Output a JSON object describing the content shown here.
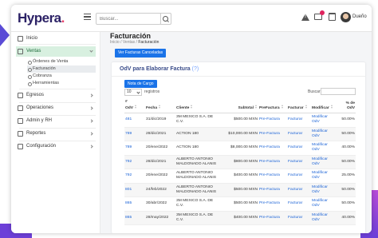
{
  "app": {
    "logo_text": "Hypera",
    "logo_dot": ".",
    "search_placeholder": "Buscar...",
    "user_name": "Dueño",
    "brand_color": "#2c2266",
    "accent_color": "#1a73e8"
  },
  "sidebar": {
    "inicio": "Inicio",
    "ventas": "Ventas",
    "ventas_sub": [
      "Órdenes de Venta",
      "Facturación",
      "Cobranza",
      "Herramientas"
    ],
    "egresos": "Egresos",
    "operaciones": "Operaciones",
    "admin": "Admin y RH",
    "reportes": "Reportes",
    "configuracion": "Configuración"
  },
  "page": {
    "title": "Facturación",
    "crumb_home": "Inicio",
    "crumb_sep": "/",
    "crumb_section": "Ventas",
    "crumb_current": "Facturación",
    "cancel_button": "Ver Facturas Canceladas"
  },
  "card": {
    "title": "OdV para Elaborar Factura",
    "title_count": "(?)",
    "new_charge_button": "Nota de Cargo",
    "page_length": "10",
    "page_length_label": "registros",
    "search_label": "Buscar:"
  },
  "table": {
    "headers": [
      "#\nOdV",
      "Fecha",
      "Cliente",
      "Subtotal",
      "PreFactura",
      "Facturar",
      "Modificar",
      "% de\nOdV"
    ],
    "rows": [
      {
        "odv": "481",
        "fecha": "31/dic/2019",
        "cliente": "3M MEXICO S.A. DE C.V.",
        "subtotal": "$500.00 MXN",
        "pre": "Pre-Factura",
        "fact": "Facturar",
        "mod": "Modificar OdV",
        "pct": "50.00%"
      },
      {
        "odv": "789",
        "fecha": "28/dic/2021",
        "cliente": "ACTION 180",
        "subtotal": "$10,000.00 MXN",
        "pre": "Pre-Factura",
        "fact": "Facturar",
        "mod": "Modificar OdV",
        "pct": "50.00%"
      },
      {
        "odv": "789",
        "fecha": "20/ene/2022",
        "cliente": "ACTION 180",
        "subtotal": "$8,000.00 MXN",
        "pre": "Pre-Factura",
        "fact": "Facturar",
        "mod": "Modificar OdV",
        "pct": "40.00%"
      },
      {
        "odv": "792",
        "fecha": "28/dic/2021",
        "cliente": "ALBERTO ANTONIO MALDONADO ALANIS",
        "subtotal": "$800.00 MXN",
        "pre": "Pre-Factura",
        "fact": "Facturar",
        "mod": "Modificar OdV",
        "pct": "50.00%"
      },
      {
        "odv": "792",
        "fecha": "20/ene/2022",
        "cliente": "ALBERTO ANTONIO MALDONADO ALANIS",
        "subtotal": "$400.00 MXN",
        "pre": "Pre-Factura",
        "fact": "Facturar",
        "mod": "Modificar OdV",
        "pct": "25.00%"
      },
      {
        "odv": "801",
        "fecha": "24/feb/2022",
        "cliente": "ALBERTO ANTONIO MALDONADO ALANIS",
        "subtotal": "$500.00 MXN",
        "pre": "Pre-Factura",
        "fact": "Facturar",
        "mod": "Modificar OdV",
        "pct": "50.00%"
      },
      {
        "odv": "865",
        "fecha": "30/abr/2022",
        "cliente": "3M MEXICO S.A. DE C.V.",
        "subtotal": "$500.00 MXN",
        "pre": "Pre-Factura",
        "fact": "Facturar",
        "mod": "Modificar OdV",
        "pct": "50.00%"
      },
      {
        "odv": "865",
        "fecha": "28/may/2022",
        "cliente": "3M MEXICO S.A. DE C.V.",
        "subtotal": "$400.00 MXN",
        "pre": "Pre-Factura",
        "fact": "Facturar",
        "mod": "Modificar OdV",
        "pct": "40.00%"
      }
    ]
  }
}
